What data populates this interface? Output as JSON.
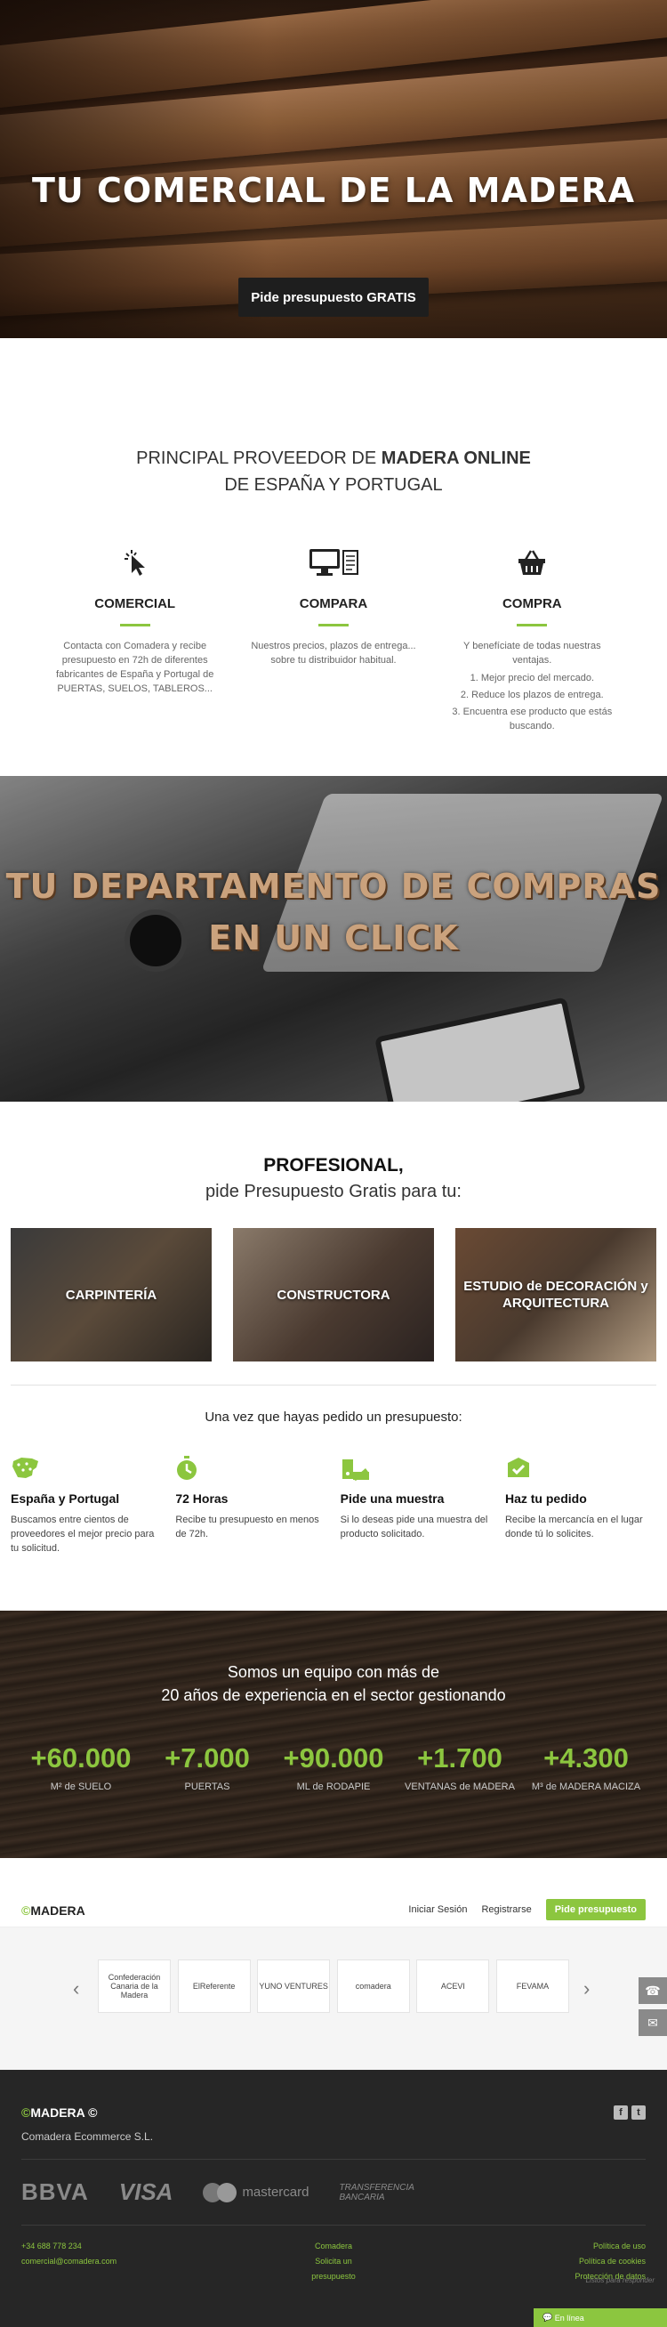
{
  "hero": {
    "title": "TU COMERCIAL DE LA MADERA",
    "cta": "Pide presupuesto GRATIS"
  },
  "intro": {
    "line1_a": "PRINCIPAL PROVEEDOR DE ",
    "line1_b": "MADERA ONLINE",
    "line2": "DE ESPAÑA Y PORTUGAL"
  },
  "features": [
    {
      "icon": "click-cursor-icon",
      "title": "COMERCIAL",
      "text": "Contacta con Comadera y recibe presupuesto en 72h de diferentes fabricantes de España y Portugal de PUERTAS, SUELOS, TABLEROS..."
    },
    {
      "icon": "monitor-document-icon",
      "title": "COMPARA",
      "text": "Nuestros precios, plazos de entrega... sobre tu distribuidor habitual."
    },
    {
      "icon": "shopping-basket-icon",
      "title": "COMPRA",
      "text": "Y benefíciate de todas nuestras ventajas.",
      "list": [
        "1. Mejor precio del mercado.",
        "2. Reduce los plazos de entrega.",
        "3. Encuentra ese producto que estás buscando."
      ]
    }
  ],
  "department": {
    "line1": "TU DEPARTAMENTO DE COMPRAS",
    "line2": "EN UN CLICK"
  },
  "professional": {
    "title": "PROFESIONAL,",
    "subtitle": "pide Presupuesto Gratis para tu:",
    "cards": [
      "CARPINTERÍA",
      "CONSTRUCTORA",
      "ESTUDIO de DECORACIÓN y ARQUITECTURA"
    ],
    "after": "Una vez que hayas pedido un presupuesto:"
  },
  "steps": [
    {
      "icon": "map-spain-icon",
      "title": "España y Portugal",
      "text": "Buscamos entre cientos de proveedores el mejor precio para tu solicitud."
    },
    {
      "icon": "stopwatch-icon",
      "title": "72 Horas",
      "text": "Recibe tu presupuesto en menos de 72h."
    },
    {
      "icon": "samples-icon",
      "title": "Pide una muestra",
      "text": "Si lo deseas pide una muestra del producto solicitado."
    },
    {
      "icon": "delivery-box-icon",
      "title": "Haz tu pedido",
      "text": "Recibe la mercancía en el lugar donde tú lo solicites."
    }
  ],
  "team": {
    "line1": "Somos un equipo con más de",
    "line2": "20 años de experiencia en el sector gestionando",
    "stats": [
      {
        "value": "+60.000",
        "label": "M² de SUELO"
      },
      {
        "value": "+7.000",
        "label": "PUERTAS"
      },
      {
        "value": "+90.000",
        "label": "ML de RODAPIE"
      },
      {
        "value": "+1.700",
        "label": "VENTANAS de MADERA"
      },
      {
        "value": "+4.300",
        "label": "M³ de MADERA MACIZA"
      }
    ]
  },
  "nav": {
    "logo": "MADERA",
    "login": "Iniciar Sesión",
    "register": "Registrarse",
    "cta": "Pide presupuesto"
  },
  "partners": [
    "Confederación Canaria de la Madera",
    "ElReferente",
    "YUNO VENTURES",
    "comadera",
    "ACEVI",
    "FEVAMA"
  ],
  "footer": {
    "logo": "MADERA",
    "company": "Comadera Ecommerce S.L.",
    "payments": {
      "bbva": "BBVA",
      "visa": "VISA",
      "mastercard": "mastercard",
      "transfer1": "TRANSFERENCIA",
      "transfer2": "BANCARIA"
    },
    "phone": "+34 688 778 234",
    "email": "comercial@comadera.com",
    "center1": "Comadera",
    "center2": "Solicita un presupuesto",
    "right1": "Política de uso",
    "right2": "Política de cookies",
    "right3": "Protección de datos",
    "help": "Listos para responder",
    "chat": "En línea"
  },
  "colors": {
    "accent": "#8cc63f",
    "dark": "#262626"
  }
}
